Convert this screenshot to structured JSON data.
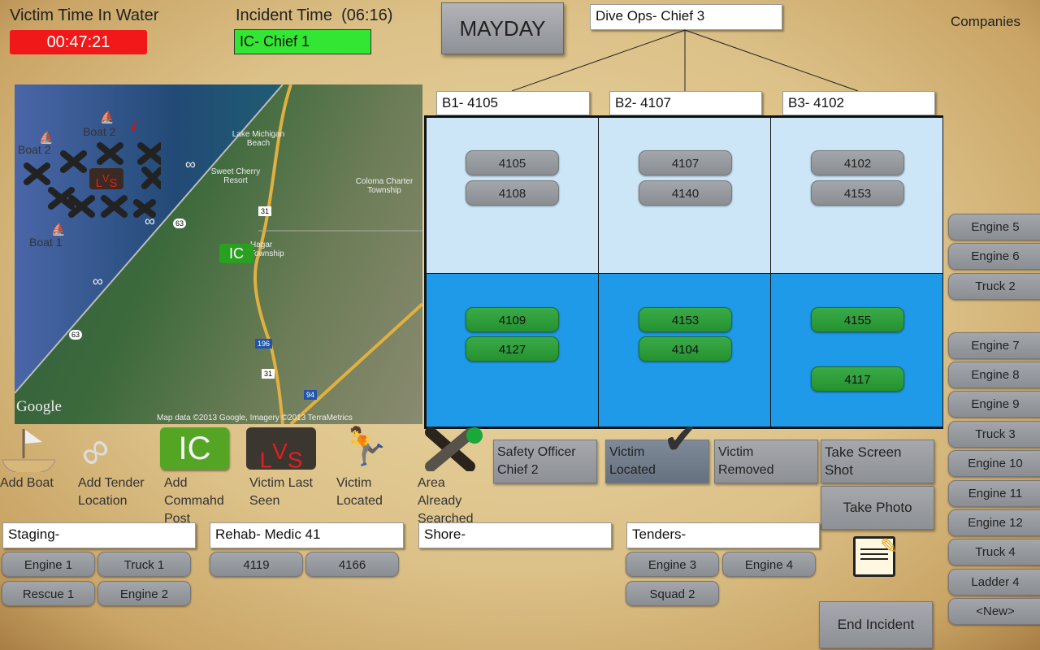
{
  "header": {
    "victim_time_label": "Victim Time In Water",
    "victim_time": "00:47:21",
    "incident_time_label": "Incident Time",
    "incident_time": "(06:16)",
    "ic": "IC- Chief 1",
    "mayday": "MAYDAY",
    "dive_ops": "Dive Ops- Chief 3",
    "companies_label": "Companies"
  },
  "colors": {
    "timer": "#f01818",
    "ic": "#33e633",
    "upper": "#cce6f8",
    "lower": "#1e9ae8",
    "pill_green": "#2aa03a"
  },
  "branches": [
    {
      "header": "B1- 4105",
      "upper": [
        "4105",
        "4108"
      ],
      "lower": [
        "4109",
        "4127"
      ]
    },
    {
      "header": "B2- 4107",
      "upper": [
        "4107",
        "4140"
      ],
      "lower": [
        "4153",
        "4104"
      ]
    },
    {
      "header": "B3- 4102",
      "upper": [
        "4102",
        "4153"
      ],
      "lower": [
        "4155",
        "4117"
      ]
    }
  ],
  "map": {
    "markers": {
      "boat2a": "Boat 2",
      "boat2b": "Boat 2",
      "boat1": "Boat 1",
      "ic": "IC",
      "lvs_l": "L",
      "lvs_v": "V",
      "lvs_s": "S"
    },
    "labels": [
      "Lake Michigan Beach",
      "Sweet Cherry Resort",
      "Coloma Charter Township",
      "Hagar Township"
    ],
    "roads": [
      "31",
      "63",
      "63",
      "196",
      "31",
      "94"
    ],
    "logo": "Google",
    "attribution": "Map data ©2013 Google, Imagery ©2013 TerraMetrics"
  },
  "tools": [
    {
      "label": "Add Boat",
      "icon": "boat-icon"
    },
    {
      "label": "Add Tender Location",
      "icon": "rope-knot-icon"
    },
    {
      "label": "Add Commahd Post",
      "icon": "ic-icon",
      "glyph": "IC"
    },
    {
      "label": "Victim Last Seen",
      "icon": "lvs-icon"
    },
    {
      "label": "Victim Located",
      "icon": "red-person-icon"
    },
    {
      "label": "Area Already Searched",
      "icon": "x-searched-icon"
    }
  ],
  "actions": {
    "safety_1": "Safety Officer",
    "safety_2": "Chief 2",
    "located_1": "Victim",
    "located_2": "Located",
    "removed_1": "Victim",
    "removed_2": "Removed",
    "screenshot_1": "Take Screen",
    "screenshot_2": "Shot",
    "photo": "Take Photo",
    "end": "End Incident"
  },
  "groups": [
    {
      "header": "Staging-",
      "items": [
        "Engine 1",
        "Truck 1",
        "Rescue 1",
        "Engine 2"
      ]
    },
    {
      "header": "Rehab-  Medic 41",
      "items": [
        "4119",
        "4166"
      ]
    },
    {
      "header": "Shore-",
      "items": []
    },
    {
      "header": "Tenders-",
      "items": [
        "Engine 3",
        "Engine 4",
        "Squad 2"
      ]
    }
  ],
  "companies": [
    "Engine 5",
    "Engine 6",
    "Truck 2",
    "Engine 7",
    "Engine 8",
    "Engine 9",
    "Truck 3",
    "Engine 10",
    "Engine 11",
    "Engine 12",
    "Truck 4",
    "Ladder 4",
    "<New>"
  ]
}
